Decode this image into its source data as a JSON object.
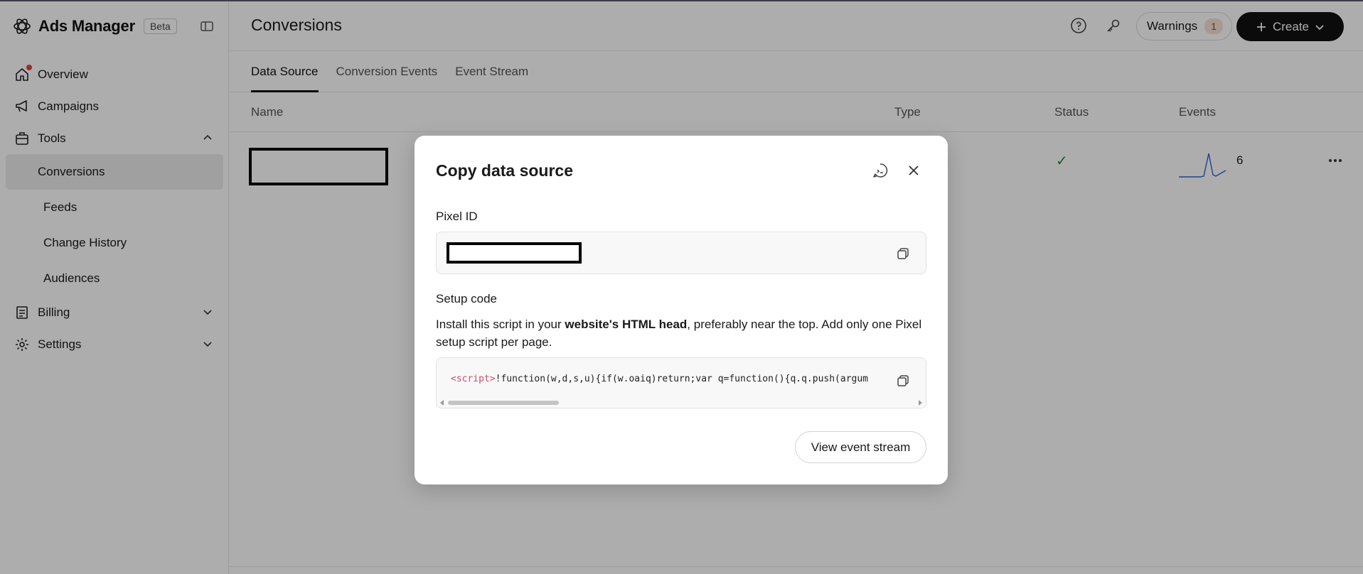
{
  "app": {
    "name": "Ads Manager",
    "badge": "Beta"
  },
  "sidebar": {
    "items": [
      {
        "label": "Overview",
        "icon": "home-icon",
        "has_notification": true
      },
      {
        "label": "Campaigns",
        "icon": "megaphone-icon"
      },
      {
        "label": "Tools",
        "icon": "toolbox-icon",
        "expanded": true,
        "children": [
          {
            "label": "Conversions",
            "active": true
          },
          {
            "label": "Feeds"
          },
          {
            "label": "Change History"
          },
          {
            "label": "Audiences"
          }
        ]
      },
      {
        "label": "Billing",
        "icon": "receipt-icon",
        "expanded": false
      },
      {
        "label": "Settings",
        "icon": "gear-icon",
        "expanded": false
      }
    ]
  },
  "header": {
    "title": "Conversions",
    "warnings_label": "Warnings",
    "warnings_count": "1",
    "create_label": "Create"
  },
  "tabs": [
    {
      "label": "Data Source",
      "active": true
    },
    {
      "label": "Conversion Events"
    },
    {
      "label": "Event Stream"
    }
  ],
  "table": {
    "columns": [
      "Name",
      "Type",
      "Status",
      "Events"
    ],
    "rows": [
      {
        "name": "[redacted]",
        "status": "✓",
        "events": "6"
      }
    ]
  },
  "modal": {
    "title": "Copy data source",
    "pixel_id_label": "Pixel ID",
    "pixel_id_value": "[redacted]",
    "setup_label": "Setup code",
    "desc_pre": "Install this script in your ",
    "desc_bold": "website's HTML head",
    "desc_post": ", preferably near the top. Add only one Pixel setup script per page.",
    "code_tag": "<script>",
    "code_body": "!function(w,d,s,u){if(w.oaiq)return;var q=function(){q.q.push(argum",
    "view_button": "View event stream"
  },
  "colors": {
    "accent": "#111111",
    "notification": "#e0443e",
    "status_ok": "#1f8a3a",
    "sparkline": "#2f5fd0",
    "code_tag": "#c8506a"
  }
}
